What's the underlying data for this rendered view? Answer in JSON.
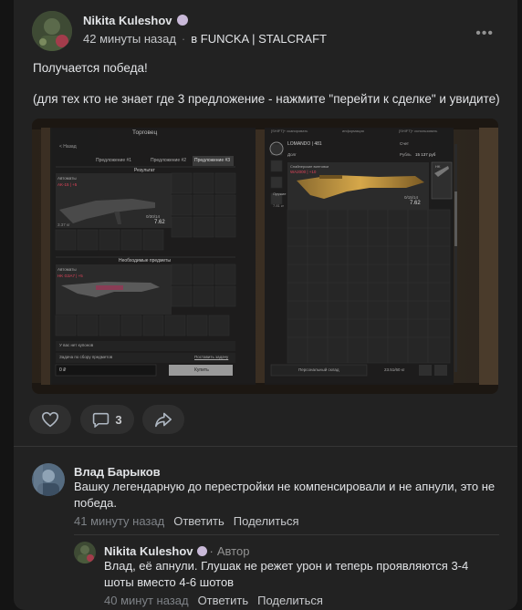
{
  "post": {
    "author": "Nikita Kuleshov",
    "time": "42 минуты назад",
    "group": "в FUNCKA | STALCRAFT",
    "more": "•••",
    "text_line1": "Получается победа!",
    "text_line2": "(для тех кто не знает где 3 предложение - нажмите \"перейти к сделке\" и увидите)"
  },
  "screenshot": {
    "trader_title": "Торговец",
    "back": "< Назад",
    "tabs": [
      "Предложение #1",
      "Предложение #2",
      "Предложение #3"
    ],
    "result_label": "Результат",
    "weapon_cat": "Автоматы",
    "weapon_name": "AK-15 | +5",
    "weapon_stats": "0/30/14",
    "weapon_val": "7.62",
    "weapon_weight": "3.37 кг",
    "needed_label": "Необходимые предметы",
    "needed_cat": "Автоматы",
    "needed_name": "HK G3A7 | +5",
    "coupons": "У вас нет купонов",
    "task_label": "Задача по сбору предметов",
    "task_link": "Поставить задачу",
    "price": "0 ₽",
    "buy": "Купить",
    "hint1": "[SHIFT]+ сканировать",
    "hint2": "информация",
    "hint3": "[SHIFT]+ использовать",
    "player": "LOMANDO | 481",
    "duty": "Долг",
    "rank_label": "Счет",
    "rubles_label": "Рубль",
    "rubles": "15 137 руб",
    "inv_item_cat": "Снайперские винтовки",
    "inv_item_name": "WA2000 | +10",
    "inv_item_stats": "0/15/14",
    "inv_item_val": "7.62",
    "inv_weapon": "Оружие",
    "inv_weight": "7.81 кг",
    "inv_slot_tag": "HK",
    "personal_storage": "Персональный склад",
    "capacity": "23.51/60 кг"
  },
  "actions": {
    "like_icon": "heart-icon",
    "comment_count": "3",
    "share_icon": "share-icon"
  },
  "comments": [
    {
      "author": "Влад Барыков",
      "text": "Вашку легендарную до перестройки не компенсировали и не апнули, это не победа.",
      "time": "41 минуту назад",
      "reply": "Ответить",
      "share": "Поделиться"
    },
    {
      "author": "Nikita Kuleshov",
      "sep": "·",
      "badge": "Автор",
      "text": "Влад, её апнули. Глушак не режет урон и теперь проявляются 3-4 шоты вместо 4-6 шотов",
      "time": "40 минут назад",
      "reply": "Ответить",
      "share": "Поделиться"
    }
  ],
  "colors": {
    "background": "#141414",
    "card": "#222222",
    "accent_red": "#e0445a",
    "gold": "#d6a84a"
  }
}
